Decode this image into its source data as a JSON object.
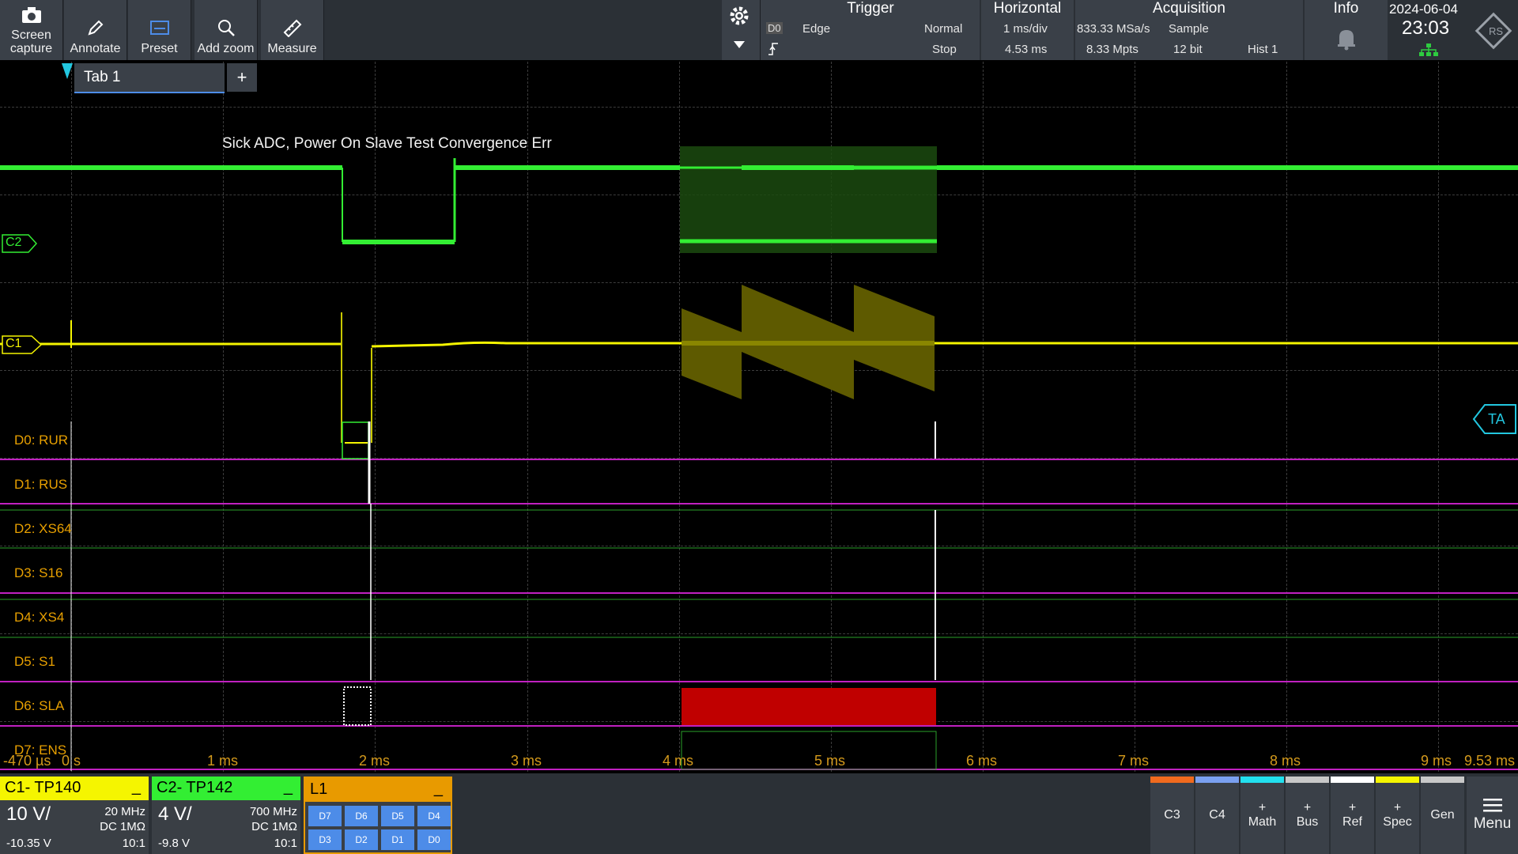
{
  "toolbar": {
    "screen_capture": "Screen capture",
    "annotate": "Annotate",
    "preset": "Preset",
    "add_zoom": "Add zoom",
    "measure": "Measure"
  },
  "trigger": {
    "title": "Trigger",
    "source": "D0",
    "type": "Edge",
    "mode": "Normal",
    "state": "Stop"
  },
  "horizontal": {
    "title": "Horizontal",
    "scale": "1 ms/div",
    "position": "4.53 ms"
  },
  "acquisition": {
    "title": "Acquisition",
    "rate": "833.33 MSa/s",
    "mode": "Sample",
    "points": "8.33 Mpts",
    "bits": "12 bit",
    "hist": "Hist 1"
  },
  "info": {
    "title": "Info"
  },
  "datetime": {
    "date": "2024-06-04",
    "time": "23:03"
  },
  "tab": {
    "label": "Tab 1",
    "add": "+"
  },
  "annotation": "Sick ADC, Power On Slave Test Convergence Err",
  "markers": {
    "c2": "C2",
    "c1": "C1",
    "ta": "TA"
  },
  "digital_labels": [
    "D0: RUR",
    "D1: RUS",
    "D2: XS64",
    "D3: S16",
    "D4: XS4",
    "D5: S1",
    "D6: SLA",
    "D7: ENS"
  ],
  "time_axis": [
    "-470 µs",
    "0 s",
    "1 ms",
    "2 ms",
    "3 ms",
    "4 ms",
    "5 ms",
    "6 ms",
    "7 ms",
    "8 ms",
    "9 ms",
    "9.53 ms"
  ],
  "channels": {
    "c1": {
      "name": "C1- TP140",
      "scale": "10 V/",
      "bw": "20 MHz",
      "coupling": "DC 1MΩ",
      "offset": "-10.35 V",
      "probe": "10:1",
      "minimize": "_"
    },
    "c2": {
      "name": "C2- TP142",
      "scale": "4 V/",
      "bw": "700 MHz",
      "coupling": "DC 1MΩ",
      "offset": "-9.8 V",
      "probe": "10:1",
      "minimize": "_"
    },
    "l1": {
      "name": "L1",
      "minimize": "_",
      "bits": [
        "D7",
        "D6",
        "D5",
        "D4",
        "D3",
        "D2",
        "D1",
        "D0"
      ]
    }
  },
  "right_buttons": {
    "c3": "C3",
    "c4": "C4",
    "math": "Math",
    "bus": "Bus",
    "ref": "Ref",
    "spec": "Spec",
    "gen": "Gen",
    "menu": "Menu",
    "plus": "+"
  },
  "colors": {
    "c1": "#f5f500",
    "c2": "#33ee33",
    "digital": "#e8a000",
    "decode": "#c00000",
    "grid": "#3c3c3c",
    "l1": "#e89a00",
    "ta": "#22c7e0"
  }
}
